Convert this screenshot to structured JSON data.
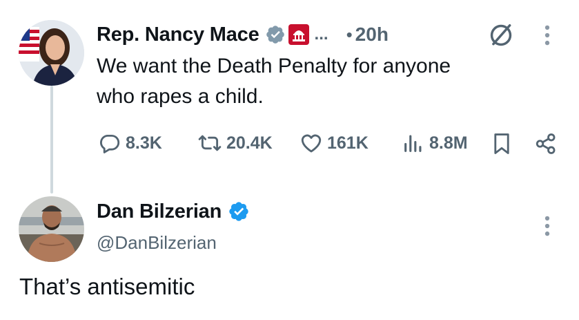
{
  "tweet": {
    "author_name": "Rep. Nancy Mace",
    "ellipsis": "...",
    "time": "20h",
    "dot": "•",
    "text_line1": "We want the Death Penalty for anyone",
    "text_line2": "who rapes a child.",
    "stats": {
      "replies": "8.3K",
      "reposts": "20.4K",
      "likes": "161K",
      "views": "8.8M"
    },
    "badge_color": "#829aab",
    "affiliation_color": "#c8102e"
  },
  "reply": {
    "author_name": "Dan Bilzerian",
    "handle": "@DanBilzerian",
    "text": "That’s antisemitic",
    "badge_color": "#1d9bf0"
  },
  "icons": [
    "reply-icon",
    "repost-icon",
    "like-icon",
    "views-icon",
    "bookmark-icon",
    "share-icon",
    "grok-icon",
    "more-icon"
  ]
}
